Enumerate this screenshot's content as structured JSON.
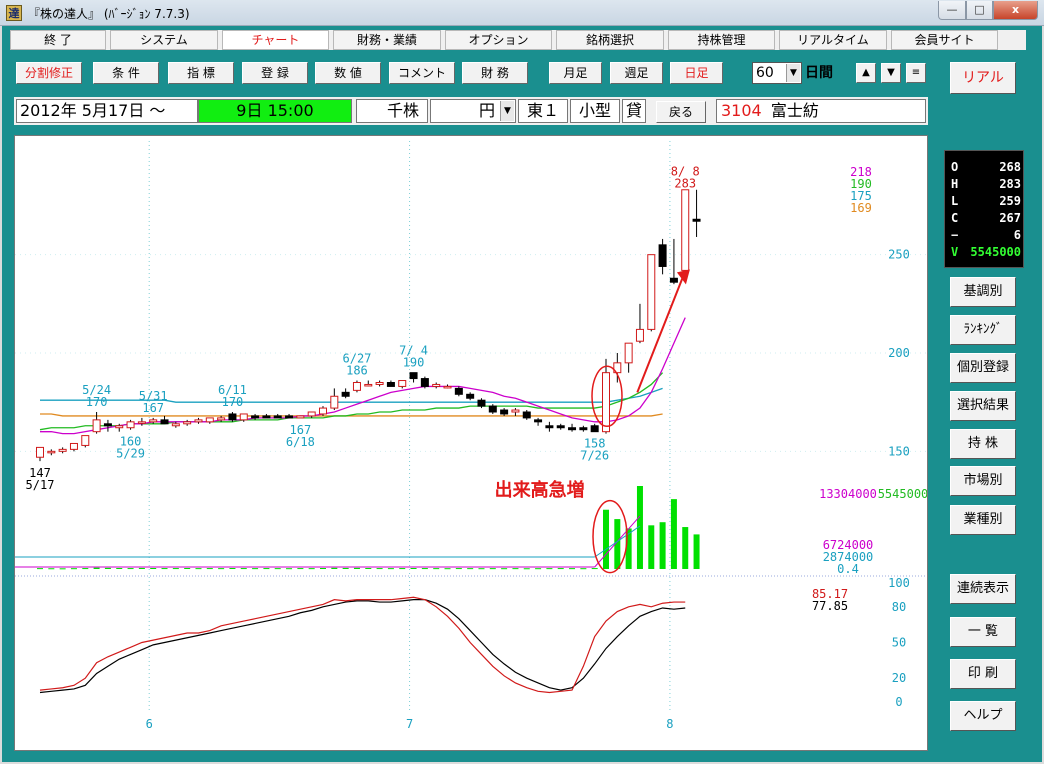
{
  "window": {
    "title": "『株の達人』 (ﾊﾞｰｼﾞｮﾝ 7.7.3)",
    "app_icon": "達",
    "minimize": "—",
    "maximize": "□",
    "close": "x"
  },
  "menu": [
    "終 了",
    "システム",
    "チャート",
    "財務・業績",
    "オプション",
    "銘柄選択",
    "持株管理",
    "リアルタイム",
    "会員サイト"
  ],
  "menu_active": "チャート",
  "toolbar": {
    "buttons": [
      "分割修正",
      "条 件",
      "指 標",
      "登 録",
      "数 値",
      "コメント",
      "財 務"
    ],
    "period_buttons": [
      "月足",
      "週足",
      "日足"
    ],
    "period_active": "日足",
    "period_value": "60",
    "period_unit": "日間",
    "nav_up": "▲",
    "nav_down": "▼",
    "nav_menu": "≡"
  },
  "info": {
    "date_from": "2012年  5月17日 ～",
    "date_to": "9日  15:00",
    "unit_shares": "千株",
    "unit_yen": "円",
    "market": "東１",
    "size": "小型",
    "margin": "貸",
    "back_button": "戻る",
    "code": "3104",
    "name": "富士紡"
  },
  "right_panel": {
    "real_button": "リアル",
    "ohlc": [
      {
        "k": "O",
        "v": "268"
      },
      {
        "k": "H",
        "v": "283"
      },
      {
        "k": "L",
        "v": "259"
      },
      {
        "k": "C",
        "v": "267"
      },
      {
        "k": "−",
        "v": "6"
      },
      {
        "k": "V",
        "v": "5545000"
      }
    ],
    "buttons_top": [
      "基調別",
      "ﾗﾝｷﾝｸﾞ",
      "個別登録",
      "選択結果",
      "持 株",
      "市場別",
      "業種別"
    ],
    "buttons_bottom": [
      "連続表示",
      "一 覧",
      "印 刷",
      "ヘルプ"
    ]
  },
  "colors": {
    "frame": "#1a8f8f",
    "candle_up": "#d11a1a",
    "candle_down": "#000000",
    "ma_short": "#cc00cc",
    "ma_mid": "#22bb22",
    "ma_long1": "#1aa0c0",
    "ma_long2": "#e08a20",
    "volume": "#00e000",
    "annotation": "#e21b1b"
  },
  "chart_data": {
    "type": "candlestick",
    "price_axis": {
      "ticks": [
        150,
        200,
        250
      ],
      "range": [
        140,
        290
      ]
    },
    "month_labels": [
      {
        "label": "6",
        "index": 10
      },
      {
        "label": "7",
        "index": 33
      },
      {
        "label": "8",
        "index": 56
      }
    ],
    "candles": [
      {
        "o": 147,
        "h": 152,
        "l": 145,
        "c": 152
      },
      {
        "o": 150,
        "h": 151,
        "l": 148,
        "c": 150
      },
      {
        "o": 150,
        "h": 152,
        "l": 149,
        "c": 151
      },
      {
        "o": 151,
        "h": 154,
        "l": 150,
        "c": 154
      },
      {
        "o": 153,
        "h": 158,
        "l": 152,
        "c": 158
      },
      {
        "o": 160,
        "h": 170,
        "l": 159,
        "c": 166
      },
      {
        "o": 164,
        "h": 166,
        "l": 160,
        "c": 163
      },
      {
        "o": 162,
        "h": 164,
        "l": 160,
        "c": 163
      },
      {
        "o": 162,
        "h": 166,
        "l": 161,
        "c": 165
      },
      {
        "o": 165,
        "h": 167,
        "l": 163,
        "c": 165
      },
      {
        "o": 165,
        "h": 167,
        "l": 164,
        "c": 166
      },
      {
        "o": 166,
        "h": 168,
        "l": 164,
        "c": 164
      },
      {
        "o": 163,
        "h": 165,
        "l": 162,
        "c": 164
      },
      {
        "o": 164,
        "h": 166,
        "l": 163,
        "c": 165
      },
      {
        "o": 165,
        "h": 167,
        "l": 164,
        "c": 166
      },
      {
        "o": 165,
        "h": 167,
        "l": 164,
        "c": 167
      },
      {
        "o": 166,
        "h": 168,
        "l": 165,
        "c": 167
      },
      {
        "o": 169,
        "h": 170,
        "l": 165,
        "c": 166
      },
      {
        "o": 166,
        "h": 169,
        "l": 165,
        "c": 169
      },
      {
        "o": 168,
        "h": 169,
        "l": 166,
        "c": 167
      },
      {
        "o": 168,
        "h": 169,
        "l": 167,
        "c": 167
      },
      {
        "o": 168,
        "h": 169,
        "l": 167,
        "c": 167
      },
      {
        "o": 168,
        "h": 169,
        "l": 167,
        "c": 167
      },
      {
        "o": 167,
        "h": 168,
        "l": 167,
        "c": 168
      },
      {
        "o": 168,
        "h": 170,
        "l": 167,
        "c": 170
      },
      {
        "o": 169,
        "h": 173,
        "l": 168,
        "c": 172
      },
      {
        "o": 172,
        "h": 182,
        "l": 171,
        "c": 178
      },
      {
        "o": 180,
        "h": 182,
        "l": 177,
        "c": 178
      },
      {
        "o": 181,
        "h": 186,
        "l": 180,
        "c": 185
      },
      {
        "o": 184,
        "h": 186,
        "l": 183,
        "c": 184
      },
      {
        "o": 184,
        "h": 186,
        "l": 183,
        "c": 185
      },
      {
        "o": 185,
        "h": 186,
        "l": 183,
        "c": 183
      },
      {
        "o": 183,
        "h": 186,
        "l": 182,
        "c": 186
      },
      {
        "o": 190,
        "h": 190,
        "l": 185,
        "c": 187
      },
      {
        "o": 187,
        "h": 188,
        "l": 182,
        "c": 183
      },
      {
        "o": 183,
        "h": 185,
        "l": 182,
        "c": 184
      },
      {
        "o": 183,
        "h": 184,
        "l": 182,
        "c": 183
      },
      {
        "o": 182,
        "h": 183,
        "l": 178,
        "c": 179
      },
      {
        "o": 179,
        "h": 180,
        "l": 176,
        "c": 177
      },
      {
        "o": 176,
        "h": 177,
        "l": 172,
        "c": 173
      },
      {
        "o": 173,
        "h": 174,
        "l": 169,
        "c": 170
      },
      {
        "o": 171,
        "h": 172,
        "l": 168,
        "c": 169
      },
      {
        "o": 170,
        "h": 172,
        "l": 168,
        "c": 171
      },
      {
        "o": 170,
        "h": 171,
        "l": 166,
        "c": 167
      },
      {
        "o": 166,
        "h": 167,
        "l": 163,
        "c": 165
      },
      {
        "o": 163,
        "h": 165,
        "l": 160,
        "c": 162
      },
      {
        "o": 163,
        "h": 164,
        "l": 161,
        "c": 162
      },
      {
        "o": 162,
        "h": 164,
        "l": 160,
        "c": 161
      },
      {
        "o": 162,
        "h": 163,
        "l": 160,
        "c": 161
      },
      {
        "o": 163,
        "h": 164,
        "l": 160,
        "c": 160
      },
      {
        "o": 160,
        "h": 197,
        "l": 159,
        "c": 190
      },
      {
        "o": 190,
        "h": 200,
        "l": 185,
        "c": 195
      },
      {
        "o": 195,
        "h": 205,
        "l": 190,
        "c": 205
      },
      {
        "o": 206,
        "h": 225,
        "l": 205,
        "c": 212
      },
      {
        "o": 212,
        "h": 240,
        "l": 211,
        "c": 250
      },
      {
        "o": 255,
        "h": 258,
        "l": 240,
        "c": 244
      },
      {
        "o": 238,
        "h": 258,
        "l": 235,
        "c": 236
      },
      {
        "o": 242,
        "h": 281,
        "l": 239,
        "c": 283
      },
      {
        "o": 268,
        "h": 283,
        "l": 259,
        "c": 267
      }
    ],
    "ma_short": [
      160,
      160,
      159,
      159,
      160,
      161,
      162,
      163,
      164,
      164,
      165,
      165,
      165,
      165,
      165,
      165,
      166,
      166,
      166,
      167,
      167,
      167,
      167,
      168,
      168,
      169,
      170,
      172,
      174,
      176,
      178,
      180,
      181,
      182,
      183,
      183,
      183,
      183,
      182,
      181,
      180,
      178,
      177,
      175,
      173,
      171,
      169,
      167,
      166,
      165,
      165,
      166,
      168,
      172,
      180,
      192,
      205,
      218
    ],
    "ma_mid": [
      161,
      162,
      162,
      162,
      163,
      163,
      163,
      163,
      164,
      164,
      164,
      164,
      165,
      165,
      165,
      165,
      165,
      165,
      166,
      166,
      166,
      166,
      167,
      167,
      167,
      167,
      168,
      168,
      169,
      169,
      170,
      170,
      171,
      171,
      171,
      172,
      172,
      172,
      173,
      173,
      173,
      173,
      173,
      173,
      172,
      172,
      172,
      172,
      172,
      172,
      173,
      175,
      177,
      180,
      184,
      190
    ],
    "ma_long1": [
      176,
      176,
      176,
      176,
      176,
      176,
      176,
      176,
      176,
      176,
      176,
      176,
      175,
      175,
      175,
      175,
      175,
      175,
      175,
      175,
      175,
      175,
      175,
      175,
      175,
      175,
      175,
      175,
      175,
      175,
      175,
      175,
      175,
      175,
      175,
      175,
      175,
      175,
      175,
      175,
      175,
      175,
      175,
      175,
      175,
      175,
      175,
      175,
      175,
      175,
      175,
      176,
      177,
      178,
      180,
      182
    ],
    "ma_long2": [
      169,
      169,
      168,
      168,
      168,
      168,
      168,
      168,
      168,
      168,
      168,
      168,
      168,
      168,
      168,
      168,
      168,
      168,
      168,
      168,
      168,
      168,
      168,
      168,
      168,
      168,
      168,
      168,
      168,
      168,
      168,
      168,
      168,
      168,
      168,
      168,
      168,
      168,
      168,
      168,
      168,
      168,
      168,
      168,
      168,
      168,
      168,
      168,
      168,
      168,
      168,
      168,
      168,
      168,
      168,
      169
    ],
    "price_labels": [
      {
        "text": "147",
        "i": 0,
        "pos": "below"
      },
      {
        "text": "5/17",
        "i": 0,
        "pos": "below2"
      },
      {
        "text": "5/24",
        "i": 5,
        "pos": "above2"
      },
      {
        "text": "170",
        "i": 5,
        "pos": "above"
      },
      {
        "text": "160",
        "i": 8,
        "pos": "below"
      },
      {
        "text": "5/29",
        "i": 8,
        "pos": "below2"
      },
      {
        "text": "5/31",
        "i": 10,
        "pos": "above2"
      },
      {
        "text": "167",
        "i": 10,
        "pos": "above"
      },
      {
        "text": "6/11",
        "i": 17,
        "pos": "above2"
      },
      {
        "text": "170",
        "i": 17,
        "pos": "above"
      },
      {
        "text": "167",
        "i": 23,
        "pos": "below"
      },
      {
        "text": "6/18",
        "i": 23,
        "pos": "below2"
      },
      {
        "text": "6/27",
        "i": 28,
        "pos": "above2"
      },
      {
        "text": "186",
        "i": 28,
        "pos": "above"
      },
      {
        "text": "7/ 4",
        "i": 33,
        "pos": "above2"
      },
      {
        "text": "190",
        "i": 33,
        "pos": "above"
      },
      {
        "text": "158",
        "i": 49,
        "pos": "below"
      },
      {
        "text": "7/26",
        "i": 49,
        "pos": "below2"
      },
      {
        "text": "8/ 8",
        "i": 57,
        "pos": "above2"
      },
      {
        "text": "283",
        "i": 57,
        "pos": "above"
      }
    ],
    "ma_values": [
      {
        "text": "218",
        "color": "#cc00cc"
      },
      {
        "text": "190",
        "color": "#22bb22"
      },
      {
        "text": "175",
        "color": "#1aa0c0"
      },
      {
        "text": "169",
        "color": "#e08a20"
      }
    ],
    "volume": [
      140000,
      120000,
      110000,
      130000,
      150000,
      210000,
      180000,
      160000,
      150000,
      170000,
      160000,
      150000,
      150000,
      160000,
      140000,
      150000,
      140000,
      160000,
      150000,
      140000,
      150000,
      140000,
      130000,
      150000,
      140000,
      160000,
      190000,
      170000,
      180000,
      160000,
      150000,
      140000,
      150000,
      160000,
      150000,
      140000,
      130000,
      150000,
      140000,
      130000,
      140000,
      130000,
      140000,
      120000,
      130000,
      140000,
      150000,
      140000,
      130000,
      150000,
      9500000,
      8000000,
      6500000,
      13304000,
      7000000,
      7500000,
      11200000,
      6724000,
      5545000
    ],
    "volume_labels": {
      "max": "13304000",
      "last": "5545000",
      "v1": "6724000",
      "v2": "2874000",
      "v3": "0.4"
    },
    "volume_annotation": "出来高急増",
    "oscillator": {
      "ticks": [
        0,
        20,
        50,
        80,
        100
      ],
      "line_red": [
        10,
        11,
        12,
        14,
        20,
        33,
        38,
        42,
        46,
        50,
        52,
        54,
        56,
        58,
        58,
        60,
        64,
        66,
        68,
        70,
        72,
        74,
        76,
        78,
        80,
        82,
        86,
        85,
        86,
        86,
        86,
        86,
        87,
        88,
        86,
        80,
        72,
        62,
        50,
        40,
        30,
        22,
        16,
        12,
        9,
        8,
        9,
        10,
        30,
        55,
        68,
        76,
        80,
        82,
        80,
        83,
        84,
        84
      ],
      "line_black": [
        8,
        9,
        10,
        11,
        14,
        24,
        30,
        36,
        40,
        44,
        48,
        50,
        52,
        54,
        56,
        58,
        60,
        62,
        64,
        66,
        68,
        70,
        72,
        75,
        77,
        80,
        82,
        84,
        85,
        85,
        84,
        84,
        85,
        86,
        86,
        83,
        78,
        70,
        60,
        50,
        40,
        32,
        25,
        20,
        16,
        12,
        10,
        12,
        20,
        32,
        45,
        55,
        64,
        72,
        76,
        79,
        78,
        79
      ],
      "value_red": "85.17",
      "value_black": "77.85"
    }
  }
}
